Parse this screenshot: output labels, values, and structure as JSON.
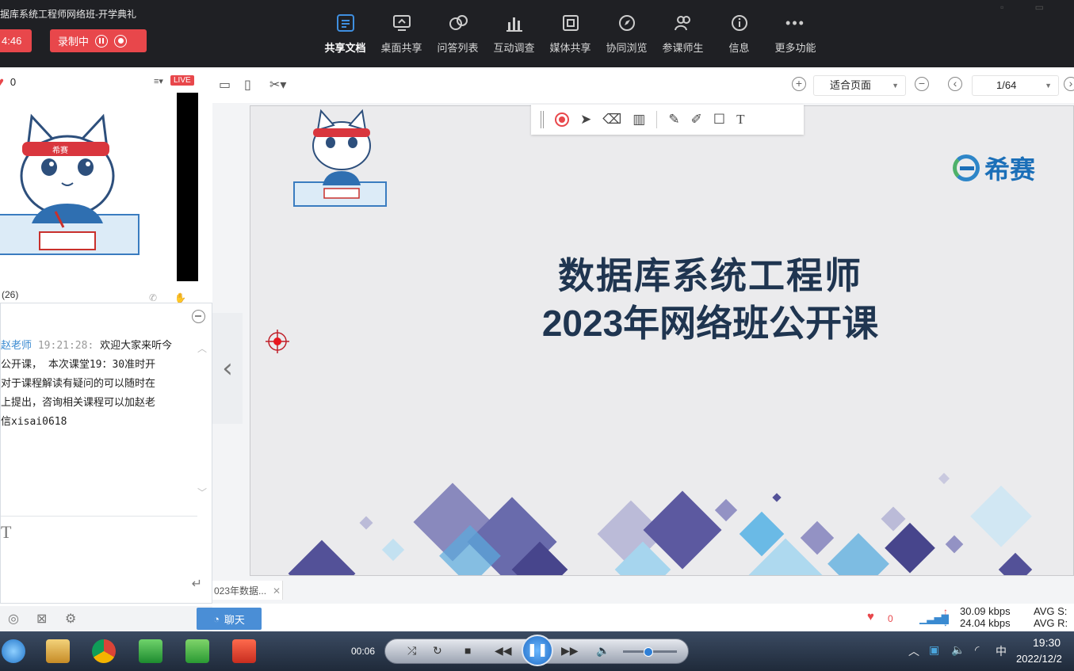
{
  "window": {
    "title": "据库系统工程师网络班-开学典礼"
  },
  "header": {
    "timer": "4:46",
    "recording_label": "录制中",
    "nav": [
      {
        "label": "共享文档",
        "icon": "document-icon",
        "active": true
      },
      {
        "label": "桌面共享",
        "icon": "desktop-share-icon"
      },
      {
        "label": "问答列表",
        "icon": "qa-icon"
      },
      {
        "label": "互动调查",
        "icon": "survey-chart-icon"
      },
      {
        "label": "媒体共享",
        "icon": "media-film-icon"
      },
      {
        "label": "协同浏览",
        "icon": "browse-compass-icon"
      },
      {
        "label": "参课师生",
        "icon": "participants-icon"
      },
      {
        "label": "信息",
        "icon": "info-icon"
      },
      {
        "label": "更多功能",
        "icon": "more-icon"
      }
    ]
  },
  "left_panel": {
    "like_count": "0",
    "live_badge": "LIVE",
    "members_label": "(26)",
    "chat": {
      "sender": "赵老师",
      "time": "19:21:28:",
      "lines": [
        "欢迎大家来听今",
        "公开课， 本次课堂19：30准时开",
        "对于课程解读有疑问的可以随时在",
        "上提出，咨询相关课程可以加赵老",
        "信xisai0618"
      ],
      "input_icon": "T"
    },
    "chat_button": "聊天"
  },
  "doc_toolbar": {
    "fit_option": "适合页面",
    "page": "1/64",
    "tab_label": "023年数据..."
  },
  "slide": {
    "title": "数据库系统工程师",
    "subtitle": "2023年网络班公开课",
    "logo_text": "希赛",
    "colors": {
      "title": "#1f3550",
      "accent": "#2e86c8"
    }
  },
  "status": {
    "likes": "0",
    "upload_rate": "30.09 kbps",
    "download_rate": "24.04 kbps",
    "avg_s": "AVG S:",
    "avg_r": "AVG R:"
  },
  "player": {
    "time": "00:06"
  },
  "taskbar": {
    "ime": "中",
    "clock_time": "19:30",
    "clock_date": "2022/12/2"
  }
}
